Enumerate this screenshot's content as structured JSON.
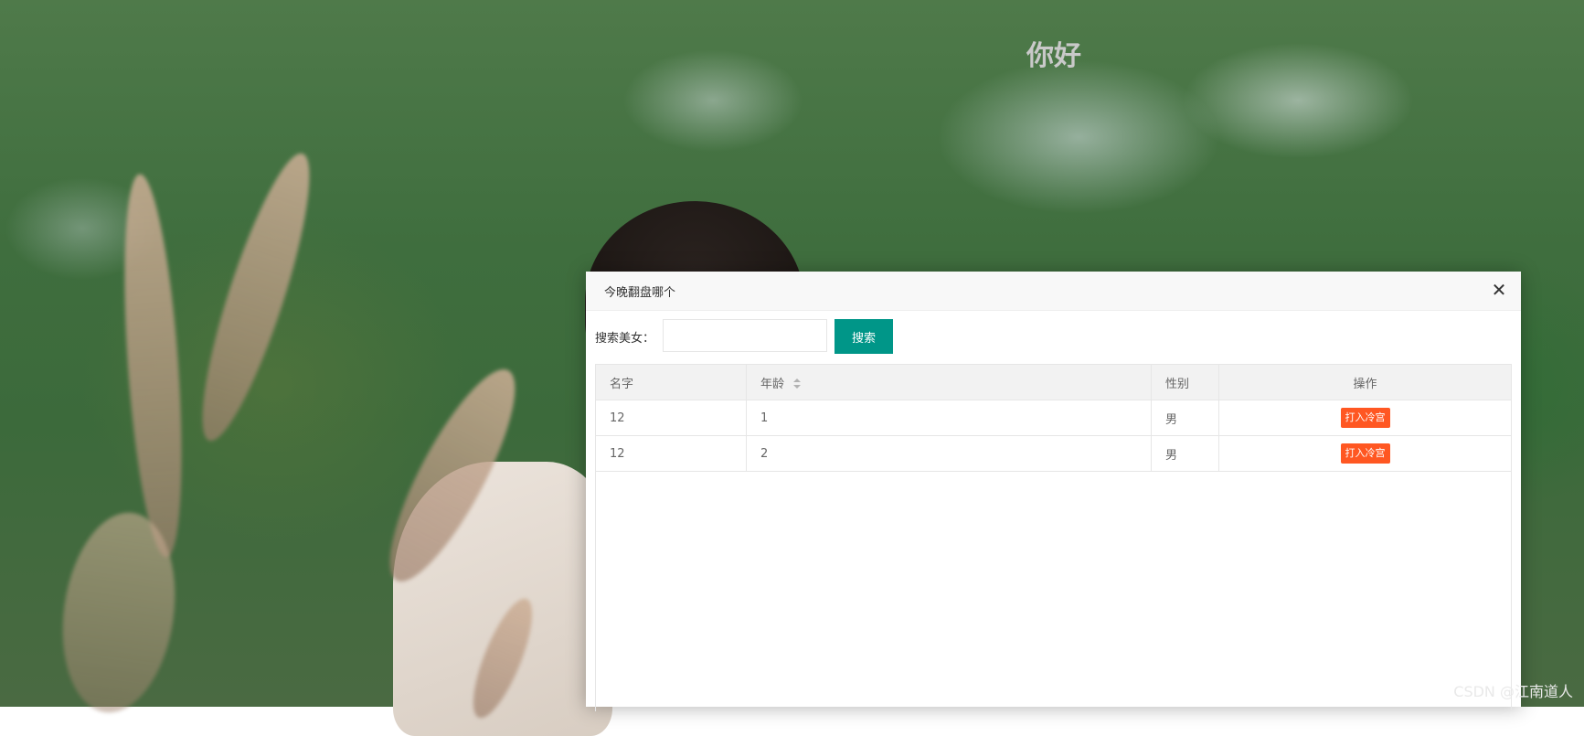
{
  "page": {
    "heading": "你好",
    "watermark": "CSDN @江南道人"
  },
  "modal": {
    "title": "今晚翻盘哪个",
    "close_icon": "close-icon",
    "search": {
      "label": "搜索美女：",
      "value": "",
      "placeholder": "",
      "button_label": "搜索"
    },
    "table": {
      "headers": {
        "name": "名字",
        "age": "年龄",
        "gender": "性别",
        "action": "操作"
      },
      "rows": [
        {
          "name": "12",
          "age": "1",
          "gender": "男",
          "action_label": "打入冷宫"
        },
        {
          "name": "12",
          "age": "2",
          "gender": "男",
          "action_label": "打入冷宫"
        }
      ]
    }
  },
  "colors": {
    "search_button": "#009688",
    "danger_button": "#ff5722"
  }
}
